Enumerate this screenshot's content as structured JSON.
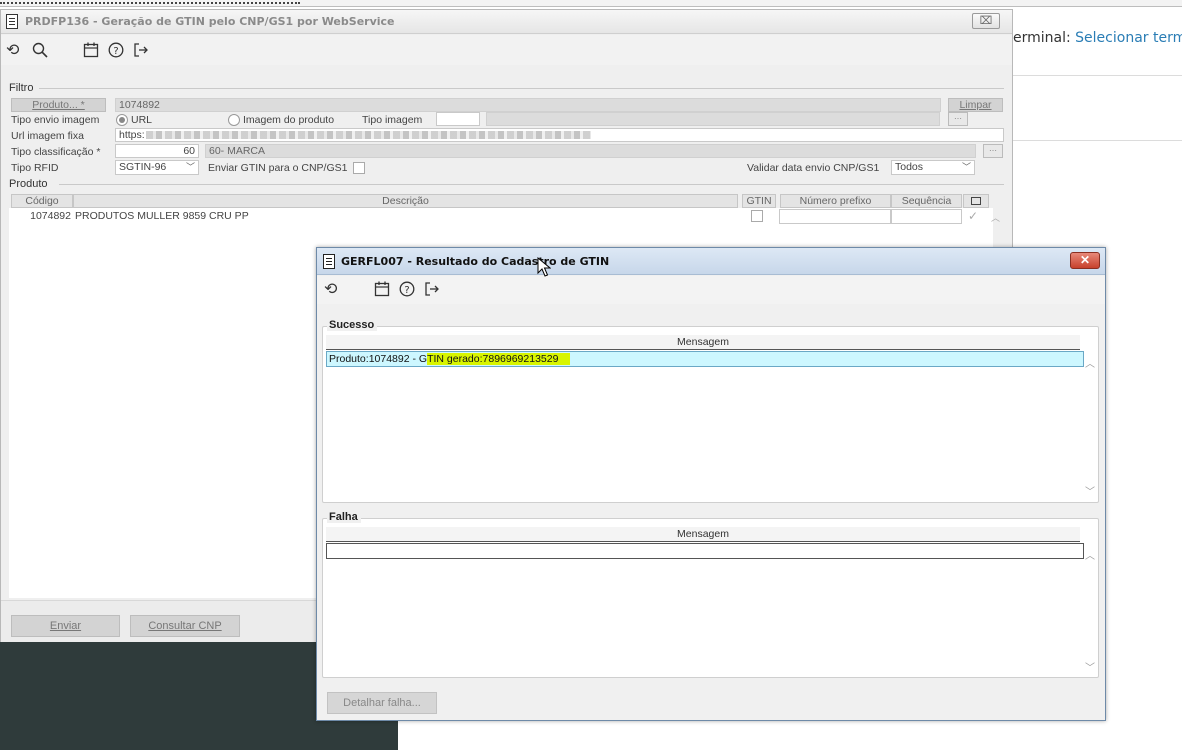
{
  "background": {
    "terminal_label": "erminal:",
    "terminal_link": "Selecionar termin"
  },
  "main_window": {
    "title": "PRDFP136 - Geração de GTIN pelo CNP/GS1 por WebService",
    "close_symbol": "⌧",
    "toolbar_icons": [
      "undo-icon",
      "search-icon",
      "calendar-icon",
      "help-icon",
      "exit-icon"
    ],
    "filtro": {
      "legend": "Filtro",
      "produto_button": "Produto... *",
      "produto_value": "1074892",
      "limpar_button": "Limpar",
      "tipo_envio_label": "Tipo envio imagem",
      "radio_url": "URL",
      "radio_imagem": "Imagem do produto",
      "tipo_imagem_label": "Tipo imagem",
      "url_label": "Url imagem fixa",
      "url_value": "https:",
      "tipo_class_label": "Tipo classificação *",
      "tipo_class_code": "60",
      "tipo_class_desc": "60- MARCA",
      "tipo_rfid_label": "Tipo RFID",
      "tipo_rfid_value": "SGTIN-96",
      "enviar_gtin_label": "Enviar GTIN para o CNP/GS1",
      "validar_label": "Validar data envio CNP/GS1",
      "validar_value": "Todos"
    },
    "produto": {
      "legend": "Produto",
      "headers": {
        "codigo": "Código",
        "descricao": "Descrição",
        "gtin": "GTIN",
        "prefixo": "Número prefixo",
        "sequencia": "Sequência"
      },
      "rows": [
        {
          "codigo": "1074892",
          "descricao": "PRODUTOS MULLER 9859 CRU PP"
        }
      ]
    },
    "footer": {
      "enviar": "Enviar",
      "consultar": "Consultar CNP"
    }
  },
  "dialog": {
    "title": "GERFL007 - Resultado do Cadastro de GTIN",
    "close_symbol": "✕",
    "toolbar_icons": [
      "undo-icon",
      "calendar-icon",
      "help-icon",
      "exit-icon"
    ],
    "sucesso": {
      "legend": "Sucesso",
      "header": "Mensagem",
      "rows": [
        {
          "prefix": "Produto:1074892 - G",
          "highlight": "TIN gerado:7896969213529"
        }
      ]
    },
    "falha": {
      "legend": "Falha",
      "header": "Mensagem"
    },
    "detalhar_button": "Detalhar falha..."
  },
  "colors": {
    "selection_row": "#cdf7ff",
    "highlight": "#d8f500",
    "link": "#2a7db5"
  }
}
